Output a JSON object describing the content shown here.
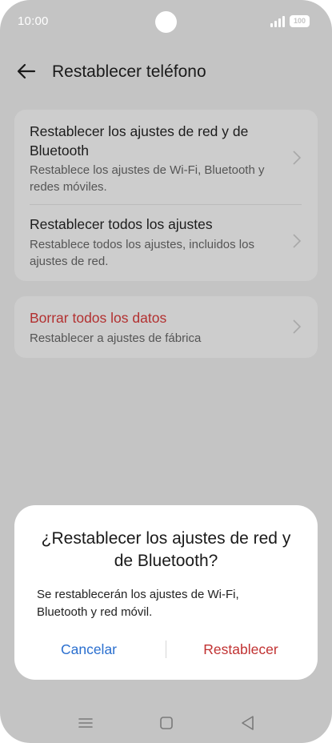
{
  "status_bar": {
    "time": "10:00",
    "battery": "100"
  },
  "header": {
    "title": "Restablecer teléfono"
  },
  "reset_options": [
    {
      "title": "Restablecer los ajustes de red y de Bluetooth",
      "subtitle": "Restablece los ajustes de Wi-Fi, Bluetooth y redes móviles."
    },
    {
      "title": "Restablecer todos los ajustes",
      "subtitle": "Restablece todos los ajustes, incluidos los ajustes de red."
    }
  ],
  "erase": {
    "title": "Borrar todos los datos",
    "subtitle": "Restablecer a ajustes de fábrica"
  },
  "dialog": {
    "title": "¿Restablecer los ajustes de red y de Bluetooth?",
    "message": "Se restablecerán los ajustes de Wi-Fi, Bluetooth y red móvil.",
    "cancel_label": "Cancelar",
    "confirm_label": "Restablecer"
  },
  "colors": {
    "scrim_background": "#c4c4c4",
    "danger": "#c13232",
    "accent": "#2a6fcf"
  },
  "icons": {
    "back": "arrow-left-icon",
    "chevron": "chevron-right-icon",
    "nav_menu": "menu-icon",
    "nav_home": "home-icon",
    "nav_back": "back-triangle-icon"
  }
}
